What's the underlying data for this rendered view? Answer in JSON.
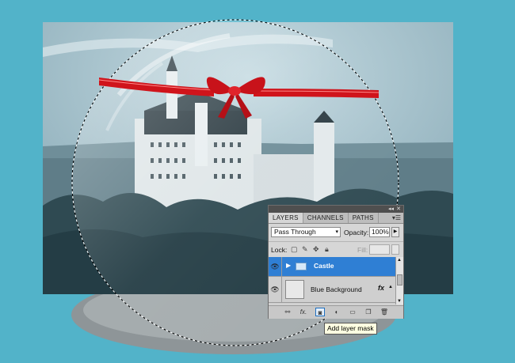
{
  "layers_panel": {
    "tabs": [
      {
        "label": "LAYERS",
        "active": true
      },
      {
        "label": "CHANNELS",
        "active": false
      },
      {
        "label": "PATHS",
        "active": false
      }
    ],
    "blend_mode": "Pass Through",
    "opacity_label": "Opacity:",
    "opacity_value": "100%",
    "lock_label": "Lock:",
    "fill_label": "Fill:",
    "layers": [
      {
        "name": "Castle",
        "type": "group",
        "selected": true,
        "visible": true
      },
      {
        "name": "Blue Background",
        "type": "layer",
        "selected": false,
        "visible": true,
        "has_effects": true,
        "fx_label": "fx"
      }
    ],
    "footer_buttons": [
      "link-layers",
      "layer-style",
      "add-layer-mask",
      "adjustment-layer",
      "new-group",
      "new-layer",
      "delete-layer"
    ]
  },
  "tooltip": {
    "text": "Add layer mask"
  },
  "colors": {
    "canvas_background": "#52b3c9",
    "selection_highlight": "#2f7fd4",
    "ribbon": "#d0141b"
  }
}
